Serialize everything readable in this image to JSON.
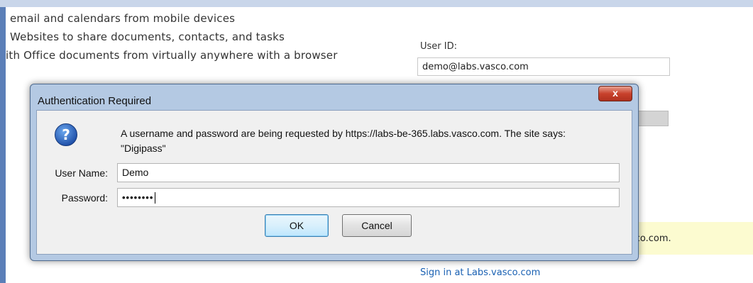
{
  "background": {
    "lines": [
      "email and calendars from mobile devices",
      "Websites to share documents, contacts, and tasks",
      "ith Office documents from virtually anywhere with a browser"
    ],
    "user_id_label": "User ID:",
    "user_id_value": "demo@labs.vasco.com",
    "notice_fragment": "sco.com.",
    "sign_in_link": "Sign in at Labs.vasco.com"
  },
  "dialog": {
    "title": "Authentication Required",
    "close_label": "x",
    "icon": "question-icon",
    "message_line1": "A username and password are being requested by https://labs-be-365.labs.vasco.com. The site says:",
    "message_line2": "\"Digipass\"",
    "username_label": "User Name:",
    "username_value": "Demo",
    "password_label": "Password:",
    "password_masked": "••••••••",
    "ok_label": "OK",
    "cancel_label": "Cancel"
  },
  "colors": {
    "dialog_frame": "#b4c9e3",
    "close_button": "#c8412c",
    "link": "#1a61b3",
    "notice_background": "#fcfbd0"
  }
}
